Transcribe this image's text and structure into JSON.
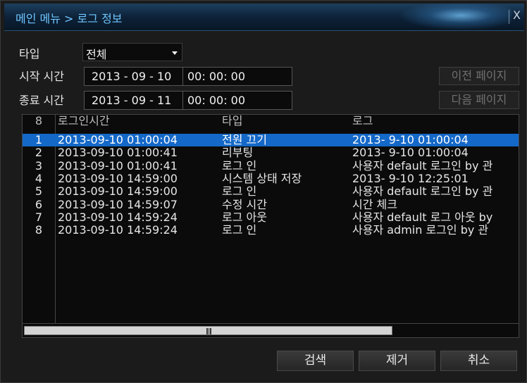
{
  "titlebar": {
    "title": "메인 메뉴 > 로그 정보",
    "close_label": "X"
  },
  "filters": {
    "type_label": "타입",
    "type_value": "전체",
    "start_label": "시작 시간",
    "start_date": "2013 - 09 - 10",
    "start_time": "00: 00: 00",
    "end_label": "종료 시간",
    "end_date": "2013 - 09 - 11",
    "end_time": "00: 00: 00"
  },
  "paging": {
    "prev_label": "이전 페이지",
    "next_label": "다음 페이지"
  },
  "table": {
    "count": "8",
    "headers": {
      "time": "로그인시간",
      "type": "타입",
      "log": "로그"
    },
    "selected_index": 0,
    "rows": [
      {
        "num": "1",
        "time": "2013-09-10 01:00:04",
        "type": "전원 끄기",
        "log": "2013- 9-10 01:00:04"
      },
      {
        "num": "2",
        "time": "2013-09-10 01:00:41",
        "type": "리부팅",
        "log": "2013- 9-10 01:00:04"
      },
      {
        "num": "3",
        "time": "2013-09-10 01:00:41",
        "type": "로그 인",
        "log": "사용자 default 로그인 by 관"
      },
      {
        "num": "4",
        "time": "2013-09-10 14:59:00",
        "type": "시스템 상태 저장",
        "log": "2013- 9-10 12:25:01"
      },
      {
        "num": "5",
        "time": "2013-09-10 14:59:00",
        "type": "로그 인",
        "log": "사용자 default 로그인 by 관"
      },
      {
        "num": "6",
        "time": "2013-09-10 14:59:07",
        "type": "수정 시간",
        "log": "시간 체크"
      },
      {
        "num": "7",
        "time": "2013-09-10 14:59:24",
        "type": "로그 아웃",
        "log": "사용자 default 로그 아웃 by"
      },
      {
        "num": "8",
        "time": "2013-09-10 14:59:24",
        "type": "로그 인",
        "log": "사용자 admin 로그인 by 관"
      }
    ]
  },
  "actions": {
    "search_label": "검색",
    "delete_label": "제거",
    "cancel_label": "취소"
  }
}
